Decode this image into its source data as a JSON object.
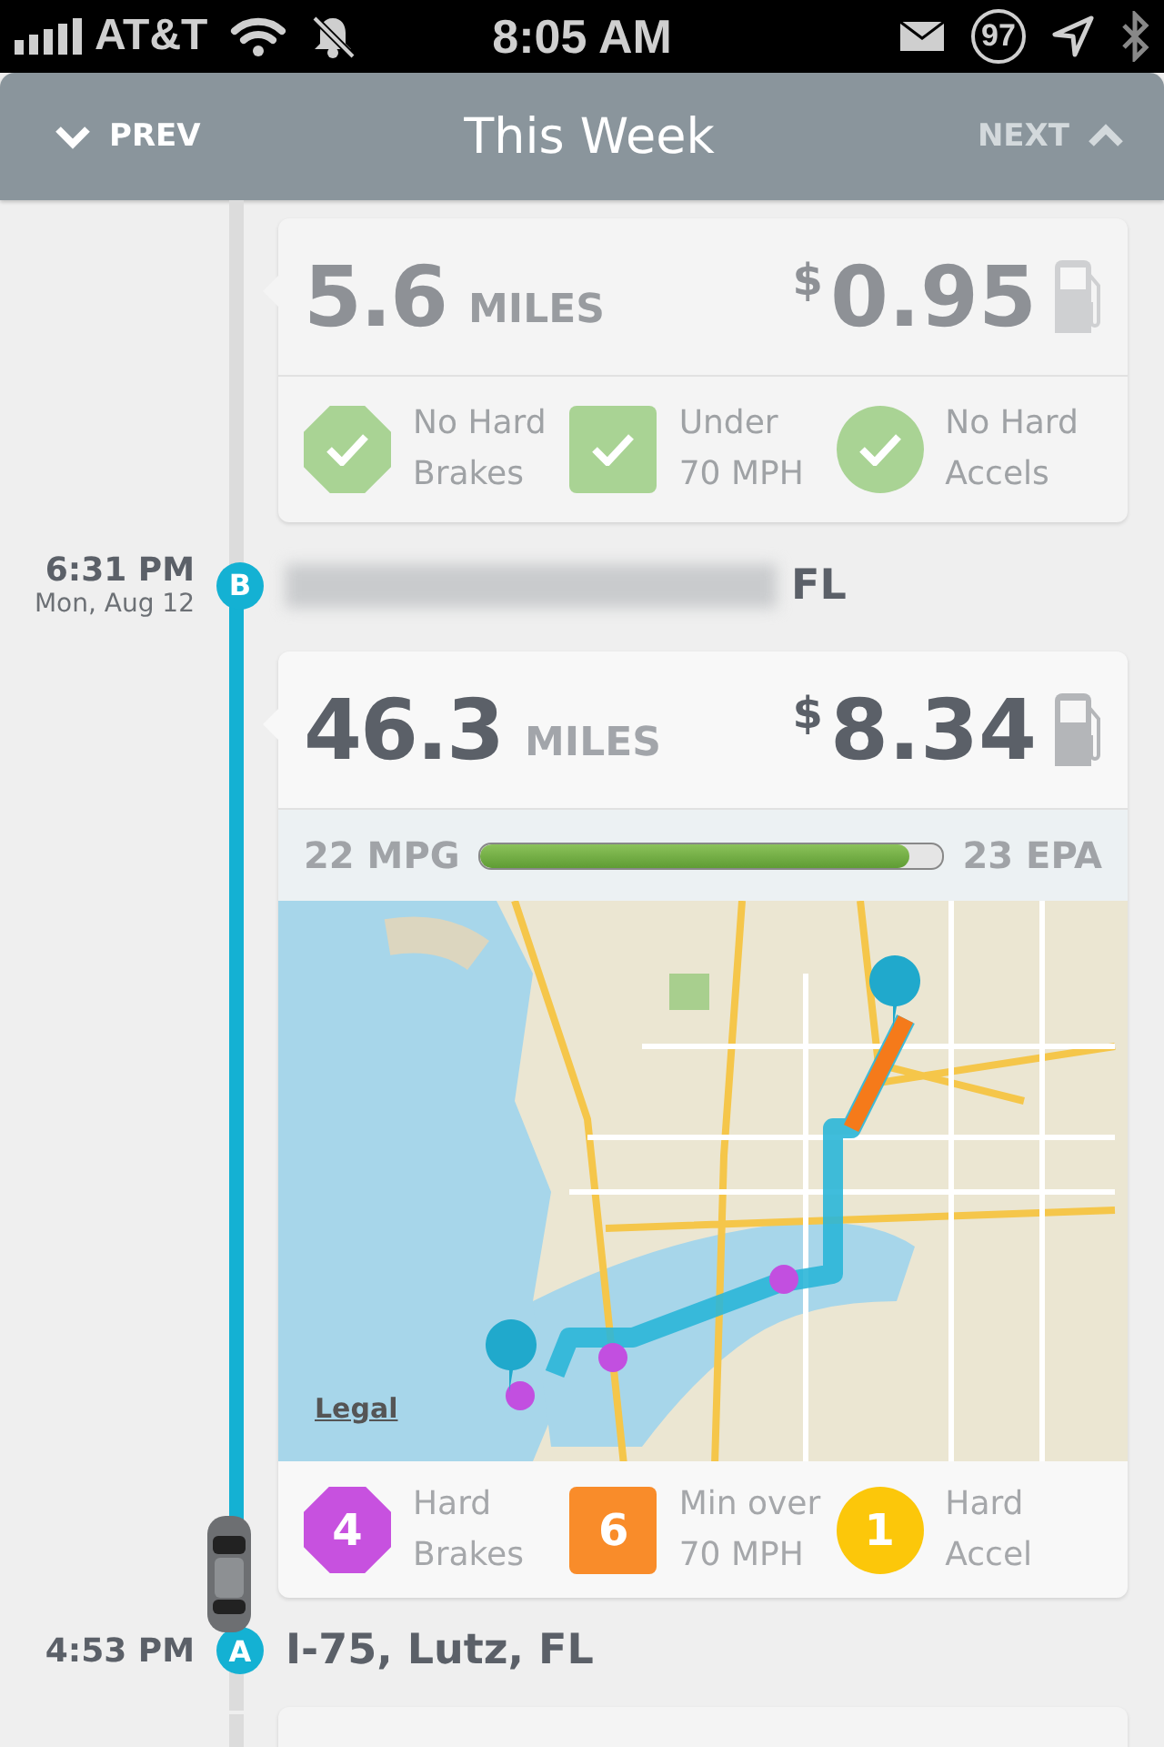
{
  "status_bar": {
    "carrier": "AT&T",
    "time": "8:05 AM",
    "battery": "97"
  },
  "header": {
    "prev": "PREV",
    "title": "This Week",
    "next": "NEXT",
    "next_disabled": true
  },
  "timeline": [
    {
      "kind": "trip",
      "active": false,
      "miles": "5.6",
      "unit": "MILES",
      "currency": "$",
      "cost": "0.95",
      "badges": [
        {
          "kind": "octagon",
          "passed": true,
          "color": "#a9d394",
          "label": "No Hard\nBrakes"
        },
        {
          "kind": "square",
          "passed": true,
          "color": "#a9d394",
          "label": "Under\n70 MPH"
        },
        {
          "kind": "circle",
          "passed": true,
          "color": "#a9d394",
          "label": "No Hard\nAccels"
        }
      ]
    },
    {
      "kind": "stop",
      "letter": "B",
      "time": "6:31 PM",
      "date": "Mon, Aug 12",
      "place_blurred": true,
      "place": "FL"
    },
    {
      "kind": "trip",
      "active": true,
      "miles": "46.3",
      "unit": "MILES",
      "currency": "$",
      "cost": "8.34",
      "mpg": {
        "value": "22 MPG",
        "epa": "23 EPA",
        "level": 0.93
      },
      "map": {
        "kind": "picture",
        "legal": "Legal"
      },
      "badges": [
        {
          "kind": "octagon",
          "passed": false,
          "color": "#c751df",
          "count": "4",
          "label": "Hard\nBrakes"
        },
        {
          "kind": "square",
          "passed": false,
          "color": "#f98c2a",
          "count": "6",
          "label": "Min over\n70 MPH"
        },
        {
          "kind": "circle",
          "passed": false,
          "color": "#fcc70a",
          "count": "1",
          "label": "Hard\nAccel"
        }
      ]
    },
    {
      "kind": "stop",
      "letter": "A",
      "time": "4:53 PM",
      "place_blurred": false,
      "place": "I-75, Lutz, FL"
    }
  ]
}
